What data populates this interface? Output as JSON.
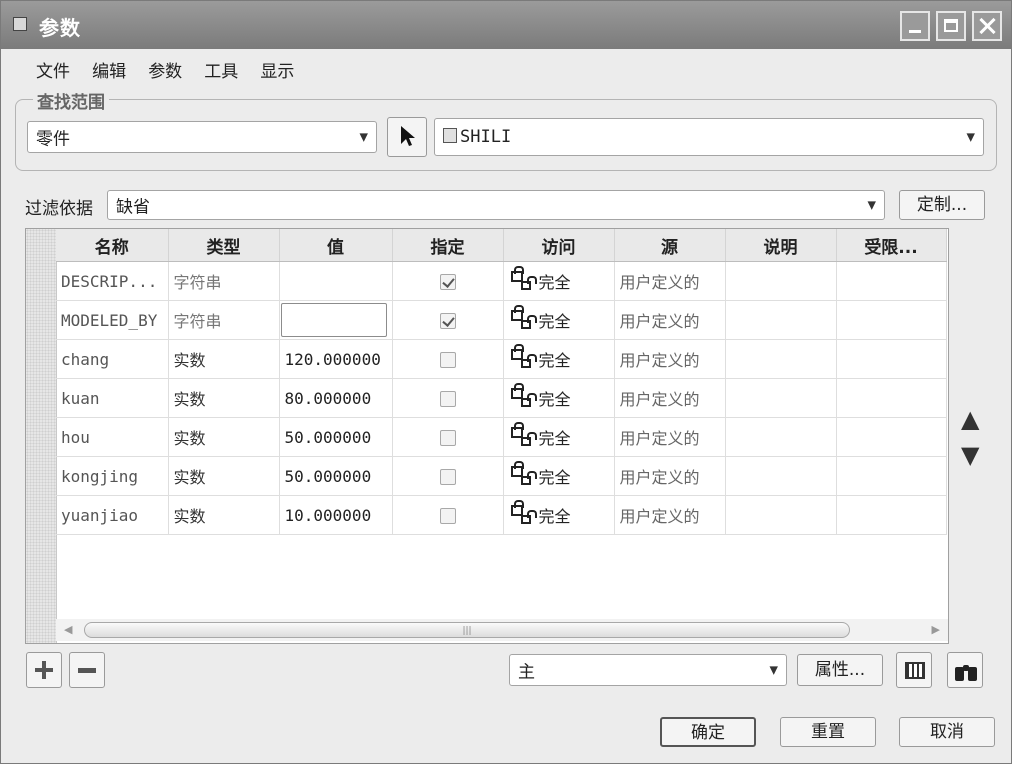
{
  "window": {
    "title": "参数"
  },
  "menu": [
    "文件",
    "编辑",
    "参数",
    "工具",
    "显示"
  ],
  "lookup": {
    "group_title": "查找范围",
    "scope_value": "零件",
    "object_value": "SHILI"
  },
  "filter": {
    "label": "过滤依据",
    "value": "缺省",
    "customize_label": "定制..."
  },
  "table": {
    "columns": [
      "名称",
      "类型",
      "值",
      "指定",
      "访问",
      "源",
      "说明",
      "受限..."
    ],
    "rows": [
      {
        "name": "DESCRIP...",
        "type": "字符串",
        "value": "",
        "designated": true,
        "access": "完全",
        "source": "用户定义的"
      },
      {
        "name": "MODELED_BY",
        "type": "字符串",
        "value": "",
        "designated": true,
        "access": "完全",
        "source": "用户定义的"
      },
      {
        "name": "chang",
        "type": "实数",
        "value": "120.000000",
        "designated": false,
        "access": "完全",
        "source": "用户定义的"
      },
      {
        "name": "kuan",
        "type": "实数",
        "value": "80.000000",
        "designated": false,
        "access": "完全",
        "source": "用户定义的"
      },
      {
        "name": "hou",
        "type": "实数",
        "value": "50.000000",
        "designated": false,
        "access": "完全",
        "source": "用户定义的"
      },
      {
        "name": "kongjing",
        "type": "实数",
        "value": "50.000000",
        "designated": false,
        "access": "完全",
        "source": "用户定义的"
      },
      {
        "name": "yuanjiao",
        "type": "实数",
        "value": "10.000000",
        "designated": false,
        "access": "完全",
        "source": "用户定义的"
      }
    ]
  },
  "bottom": {
    "view_value": "主",
    "properties_label": "属性..."
  },
  "actions": {
    "ok": "确定",
    "reset": "重置",
    "cancel": "取消"
  },
  "colors": {
    "titlebar": "#8d8d8d",
    "dialog_bg": "#ececec",
    "grid_bg": "#ffffff"
  }
}
